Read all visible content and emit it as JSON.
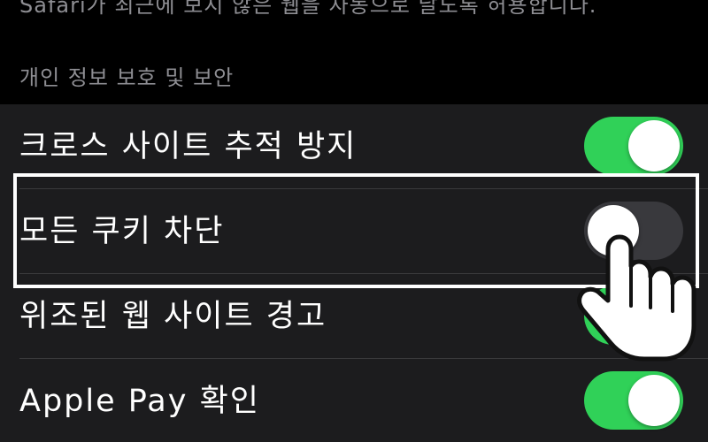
{
  "top_caption": "Safari가 최근에 보지 않은 웹을 자동으로 날도록 허용합니다.",
  "section": {
    "header": "개인 정보 보호 및 보안"
  },
  "rows": [
    {
      "label": "크로스 사이트 추적 방지",
      "toggle": "on"
    },
    {
      "label": "모든 쿠키 차단",
      "toggle": "off"
    },
    {
      "label": "위조된 웹 사이트 경고",
      "toggle": "on"
    },
    {
      "label": "Apple Pay 확인",
      "toggle": "on"
    }
  ],
  "colors": {
    "background": "#000000",
    "group_background": "#1c1c1e",
    "toggle_on": "#30d158",
    "toggle_off": "#39393d",
    "secondary_text": "#8e8e93",
    "highlight": "#ffffff"
  },
  "icons": {
    "pointer": "pointing-hand-icon"
  }
}
